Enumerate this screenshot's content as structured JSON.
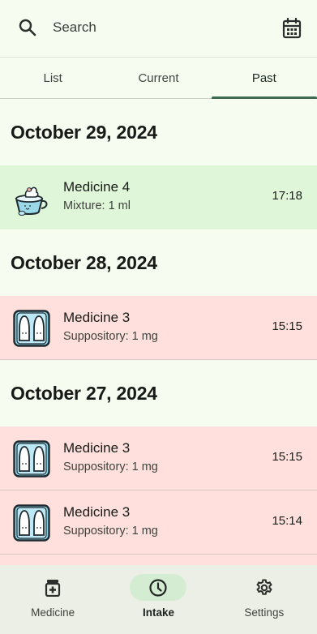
{
  "search": {
    "placeholder": "Search"
  },
  "tabs": [
    {
      "label": "List",
      "active": false
    },
    {
      "label": "Current",
      "active": false
    },
    {
      "label": "Past",
      "active": true
    }
  ],
  "groups": [
    {
      "date": "October 29, 2024",
      "entries": [
        {
          "name": "Medicine 4",
          "detail": "Mixture: 1 ml",
          "time": "17:18",
          "status": "taken",
          "icon": "mixture-cup-icon"
        }
      ]
    },
    {
      "date": "October 28, 2024",
      "entries": [
        {
          "name": "Medicine 3",
          "detail": "Suppository: 1 mg",
          "time": "15:15",
          "status": "missed",
          "icon": "suppository-icon"
        }
      ]
    },
    {
      "date": "October 27, 2024",
      "entries": [
        {
          "name": "Medicine 3",
          "detail": "Suppository: 1 mg",
          "time": "15:15",
          "status": "missed",
          "icon": "suppository-icon"
        },
        {
          "name": "Medicine 3",
          "detail": "Suppository: 1 mg",
          "time": "15:14",
          "status": "missed",
          "icon": "suppository-icon"
        }
      ]
    }
  ],
  "nav": [
    {
      "label": "Medicine",
      "icon": "medicine-bottle-icon",
      "active": false
    },
    {
      "label": "Intake",
      "icon": "clock-icon",
      "active": true
    },
    {
      "label": "Settings",
      "icon": "gear-icon",
      "active": false
    }
  ],
  "colors": {
    "taken": "#dff6d9",
    "missed": "#ffe0dc",
    "accent": "#3f6b52",
    "background": "#f6fcf0"
  }
}
